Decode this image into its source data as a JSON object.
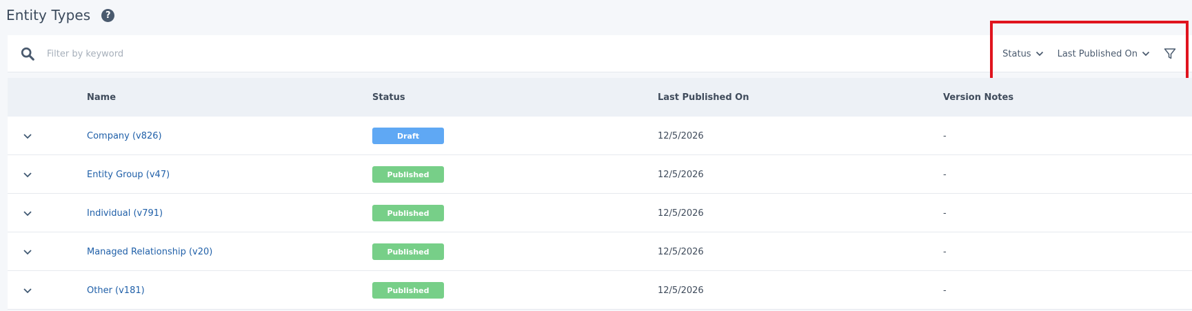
{
  "header": {
    "title": "Entity Types",
    "help_icon": "question-circle-icon",
    "help_glyph": "?"
  },
  "filter_bar": {
    "search_icon": "search-icon",
    "search_placeholder": "Filter by keyword",
    "search_value": "",
    "status_filter_label": "Status",
    "published_filter_label": "Last Published On",
    "funnel_icon": "funnel-icon"
  },
  "table": {
    "columns": {
      "name": "Name",
      "status": "Status",
      "last_published_on": "Last Published On",
      "version_notes": "Version Notes"
    },
    "rows": [
      {
        "name": "Company (v826)",
        "status": "Draft",
        "status_kind": "draft",
        "last_published_on": "12/5/2026",
        "version_notes": "-"
      },
      {
        "name": "Entity Group (v47)",
        "status": "Published",
        "status_kind": "published",
        "last_published_on": "12/5/2026",
        "version_notes": "-"
      },
      {
        "name": "Individual (v791)",
        "status": "Published",
        "status_kind": "published",
        "last_published_on": "12/5/2026",
        "version_notes": "-"
      },
      {
        "name": "Managed Relationship (v20)",
        "status": "Published",
        "status_kind": "published",
        "last_published_on": "12/5/2026",
        "version_notes": "-"
      },
      {
        "name": "Other (v181)",
        "status": "Published",
        "status_kind": "published",
        "last_published_on": "12/5/2026",
        "version_notes": "-"
      }
    ]
  },
  "colors": {
    "page_bg": "#f5f7fa",
    "header_row_bg": "#edf1f6",
    "link": "#1f5fa8",
    "draft_badge": "#5fa8f4",
    "published_badge": "#77cf88",
    "highlight": "#e0141e"
  }
}
